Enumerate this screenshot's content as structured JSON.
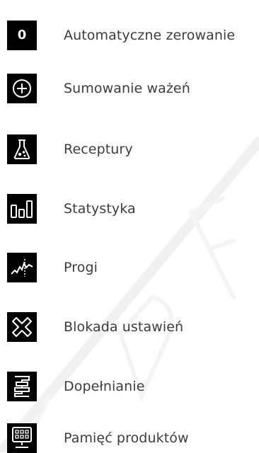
{
  "colors": {
    "icon_bg": "#000000",
    "icon_fg": "#ffffff",
    "text": "#3c3c3c"
  },
  "menu": {
    "items": [
      {
        "icon": "zero-icon",
        "glyph": "0",
        "label": "Automatyczne zerowanie"
      },
      {
        "icon": "plus-circle-icon",
        "label": "Sumowanie ważeń"
      },
      {
        "icon": "flask-icon",
        "label": "Receptury"
      },
      {
        "icon": "bar-chart-icon",
        "label": "Statystyka"
      },
      {
        "icon": "threshold-icon",
        "label": "Progi"
      },
      {
        "icon": "cross-block-icon",
        "label": "Blokada ustawień"
      },
      {
        "icon": "filling-icon",
        "label": "Dopełnianie"
      },
      {
        "icon": "product-memory-icon",
        "label": "Pamięć produktów"
      }
    ]
  }
}
